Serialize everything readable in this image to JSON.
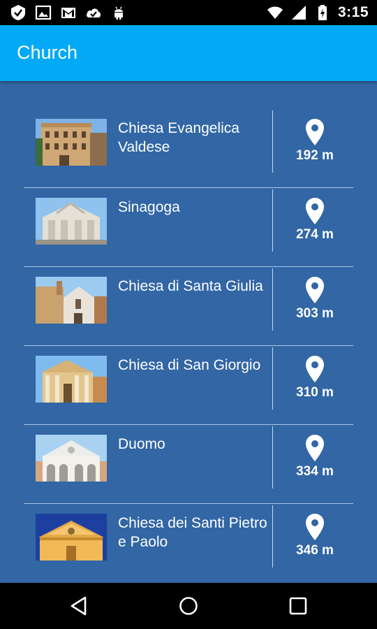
{
  "status_bar": {
    "time": "3:15",
    "left_icons": [
      "check-badge-icon",
      "image-icon",
      "gmail-icon",
      "cloud-check-icon",
      "android-icon"
    ],
    "right_icons": [
      "wifi-icon",
      "signal-icon",
      "battery-charging-icon"
    ]
  },
  "app_bar": {
    "title": "Church"
  },
  "colors": {
    "app_bar": "#03A9F4",
    "list_background": "#3266A4",
    "separator": "#AEC6E6",
    "text": "#FFFFFF"
  },
  "churches": [
    {
      "name": "Chiesa Evangelica Valdese",
      "distance": "192 m",
      "icon": "map-pin-icon"
    },
    {
      "name": "Sinagoga",
      "distance": "274 m",
      "icon": "map-pin-icon"
    },
    {
      "name": "Chiesa di Santa Giulia",
      "distance": "303 m",
      "icon": "map-pin-icon"
    },
    {
      "name": "Chiesa di San Giorgio",
      "distance": "310 m",
      "icon": "map-pin-icon"
    },
    {
      "name": "Duomo",
      "distance": "334 m",
      "icon": "map-pin-icon"
    },
    {
      "name": "Chiesa dei Santi Pietro e Paolo",
      "distance": "346 m",
      "icon": "map-pin-icon"
    }
  ],
  "nav_bar": {
    "buttons": [
      "back-icon",
      "home-icon",
      "recents-icon"
    ]
  }
}
